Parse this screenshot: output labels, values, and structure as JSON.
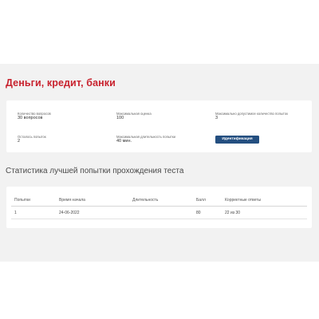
{
  "page": {
    "title": "Деньги, кредит, банки"
  },
  "info": {
    "questions_count": {
      "label": "Количество вопросов",
      "value": "30 вопросов"
    },
    "max_score": {
      "label": "Максимальная оценка",
      "value": "100"
    },
    "max_attempts": {
      "label": "Максимально допустимое количество попыток",
      "value": "3"
    },
    "attempts_left": {
      "label": "Осталось попыток",
      "value": "2"
    },
    "max_duration": {
      "label": "Максимальная длительность попытки",
      "value": "40 мин."
    },
    "identify_button": "Идентификация"
  },
  "stats": {
    "title": "Статистика лучшей попытки прохождения теста",
    "columns": [
      "Попытки",
      "Время начала",
      "Длительность",
      "Балл",
      "Корректные ответы"
    ],
    "rows": [
      [
        "1",
        "24-06-2022",
        "",
        "80",
        "22 из 30"
      ]
    ]
  },
  "colors": {
    "title_red": "#c8222e",
    "button_blue": "#244f80",
    "background_gray": "#f2f2f2"
  }
}
